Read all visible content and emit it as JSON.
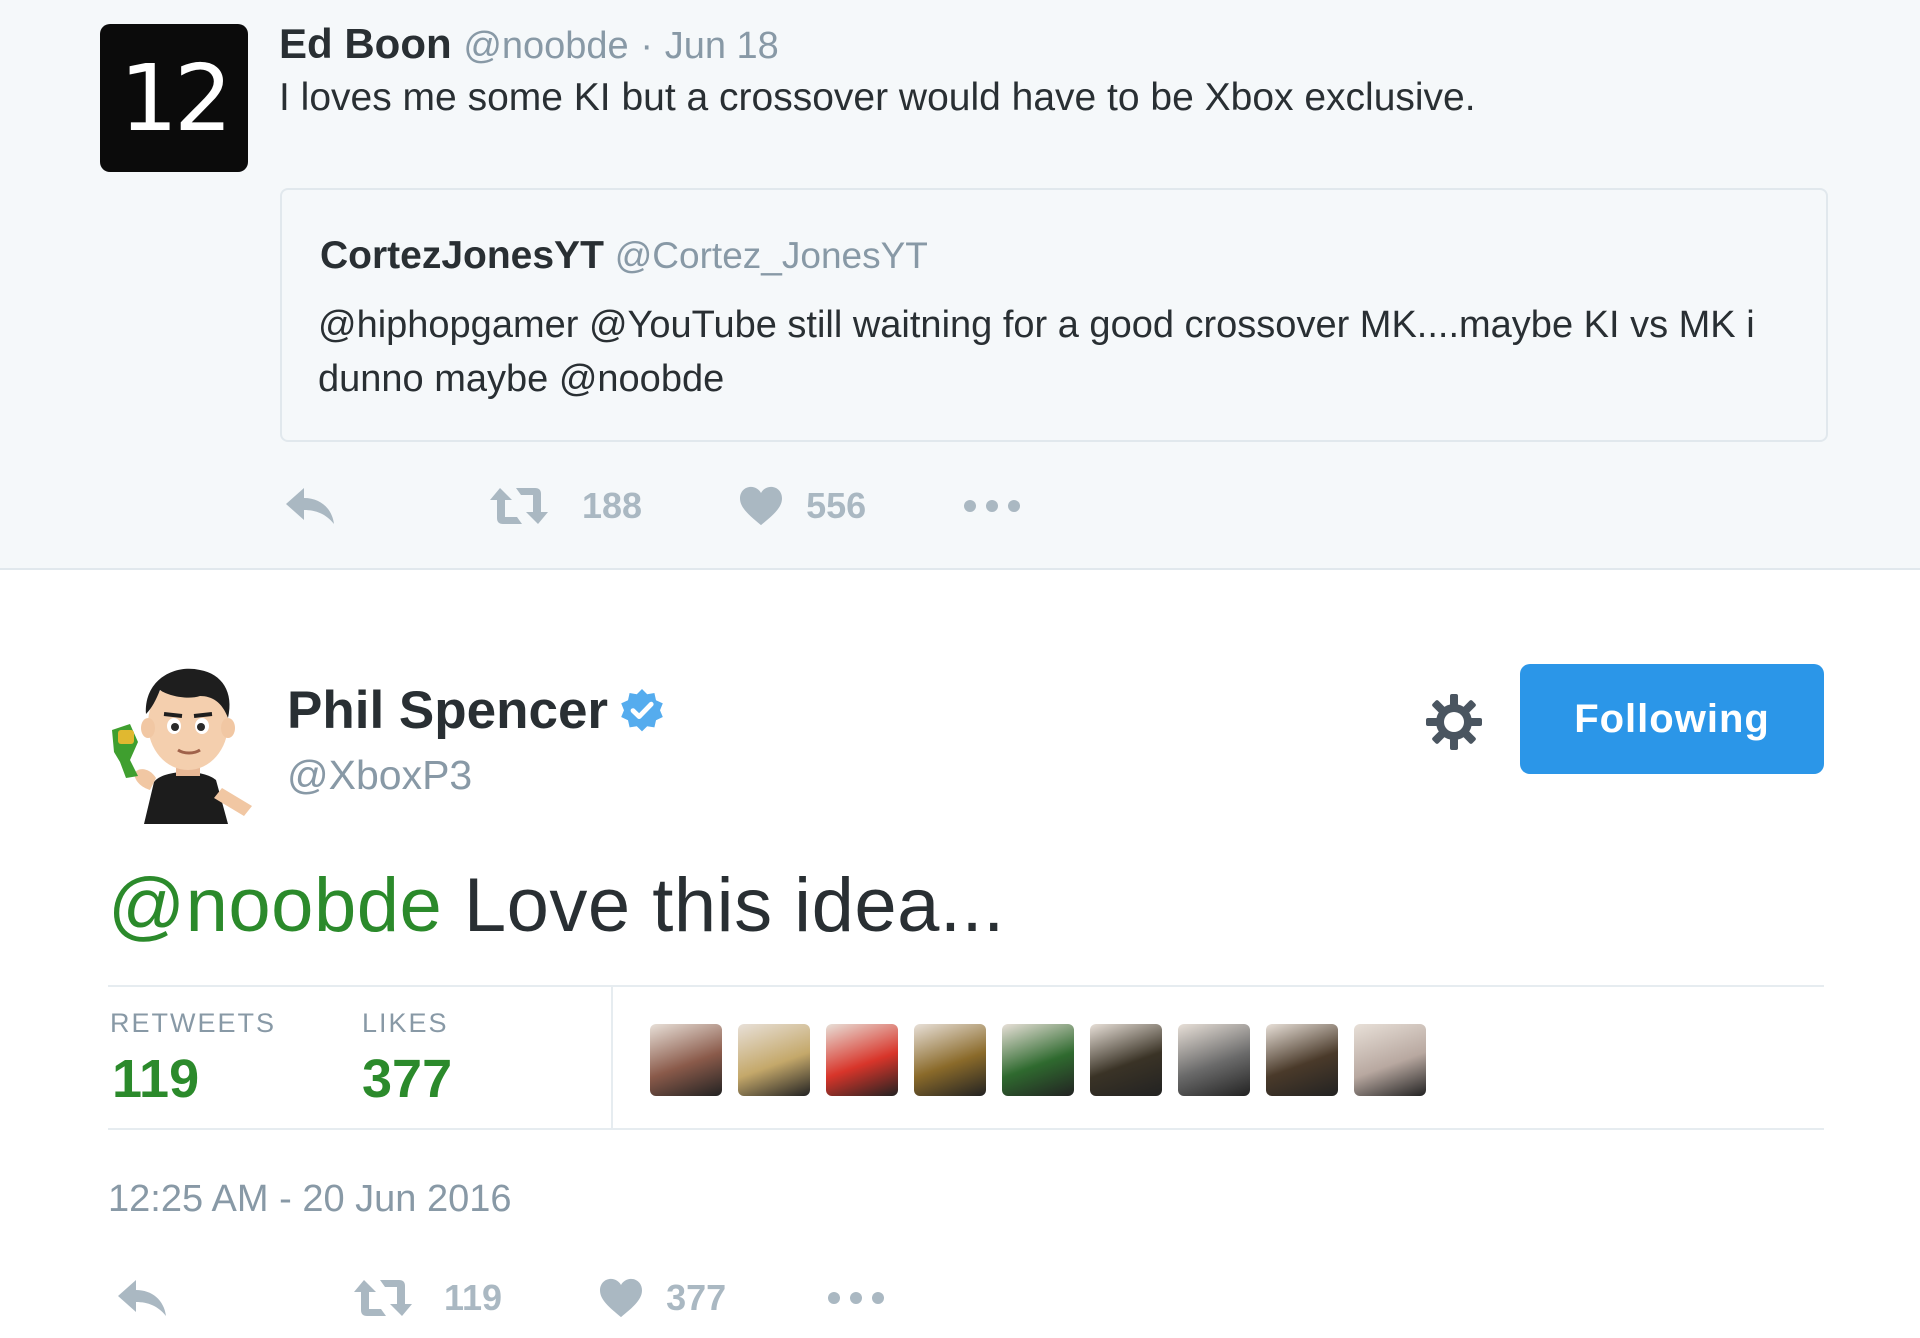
{
  "quoted_reply": {
    "avatar_text": "12",
    "author_name": "Ed Boon",
    "author_handle": "@noobde",
    "separator": "·",
    "date": "Jun 18",
    "text": "I loves me some KI but a crossover would have to be Xbox exclusive.",
    "quote": {
      "author_name": "CortezJonesYT",
      "author_handle": "@Cortez_JonesYT",
      "text": "@hiphopgamer @YouTube still waitning for a good crossover MK....maybe KI vs MK i dunno maybe @noobde"
    },
    "actions": {
      "retweets": "188",
      "likes": "556"
    }
  },
  "main_tweet": {
    "author_name": "Phil Spencer",
    "author_handle": "@XboxP3",
    "follow_label": "Following",
    "mention": "@noobde",
    "text": " Love this idea...",
    "stats": {
      "retweets_label": "RETWEETS",
      "retweets_value": "119",
      "likes_label": "LIKES",
      "likes_value": "377"
    },
    "likers": [
      {
        "color": "#8a5a4a"
      },
      {
        "color": "#c4a86a"
      },
      {
        "color": "#d8352a"
      },
      {
        "color": "#8a6a2a"
      },
      {
        "color": "#2f6a2f"
      },
      {
        "color": "#3a3326"
      },
      {
        "color": "#6a6a6a"
      },
      {
        "color": "#4a3a2a"
      },
      {
        "color": "#b8a8a0"
      }
    ],
    "timestamp": "12:25 AM - 20 Jun 2016",
    "actions": {
      "retweets": "119",
      "likes": "377"
    }
  },
  "colors": {
    "accent": "#2b96e8",
    "mention": "#2b8a2b",
    "muted": "#8899a6",
    "icon": "#aab8c2",
    "verified": "#55acee"
  }
}
